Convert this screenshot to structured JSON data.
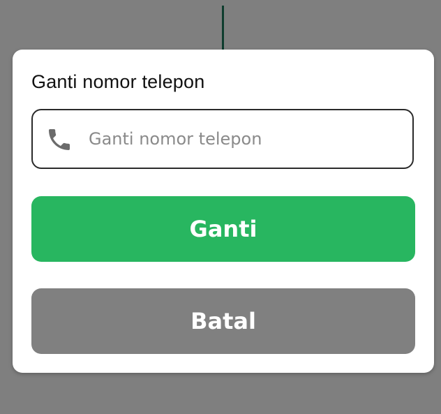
{
  "dialog": {
    "title": "Ganti nomor telepon",
    "phone_field": {
      "icon": "phone-icon",
      "placeholder": "Ganti nomor telepon",
      "value": ""
    },
    "confirm_label": "Ganti",
    "cancel_label": "Batal"
  },
  "colors": {
    "overlay": "#7f7f7f",
    "confirm_button": "#28b660",
    "cancel_button": "#808080",
    "dialog_background": "#ffffff"
  }
}
